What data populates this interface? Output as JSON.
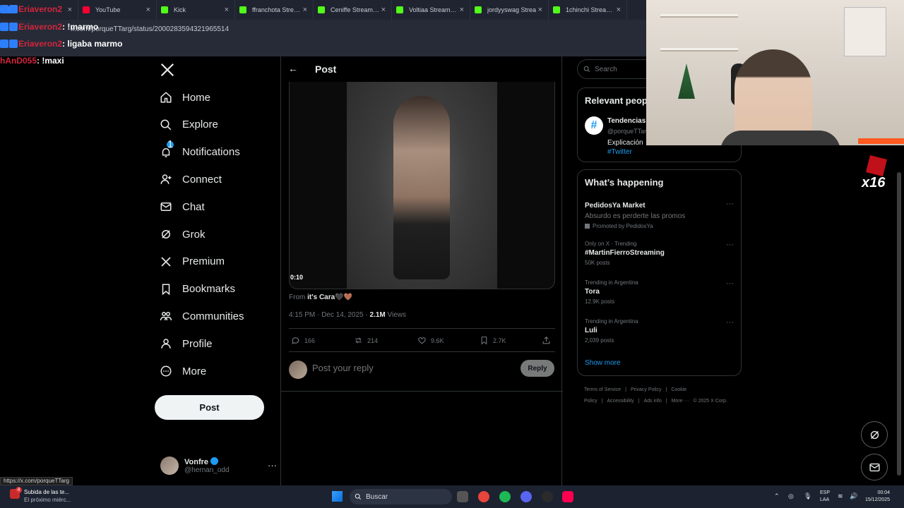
{
  "browser": {
    "tabs": [
      {
        "label": "",
        "color": "#3b82f6"
      },
      {
        "label": "YouTube",
        "color": "#ff0033"
      },
      {
        "label": "Kick",
        "color": "#53fc18"
      },
      {
        "label": "ffranchota Stream",
        "color": "#53fc18"
      },
      {
        "label": "Ceniffe Stream - Vi",
        "color": "#53fc18"
      },
      {
        "label": "Voltiaa Stream - V",
        "color": "#53fc18"
      },
      {
        "label": "jordyyswag Strea",
        "color": "#53fc18"
      },
      {
        "label": "1chinchi Stream -",
        "color": "#53fc18"
      }
    ],
    "address": "x.com/porqueTTarg/status/2000283594321965514"
  },
  "chat": [
    {
      "user": "Eriaveron2",
      "msg": ""
    },
    {
      "user": "Eriaveron2",
      "msg": ": !marmo"
    },
    {
      "user": "Eriaveron2",
      "msg": ": ligaba marmo"
    },
    {
      "user": "hAnD055",
      "msg": ": !maxi"
    }
  ],
  "nav": {
    "items": [
      {
        "label": "Home",
        "icon": "home-icon"
      },
      {
        "label": "Explore",
        "icon": "search-icon"
      },
      {
        "label": "Notifications",
        "icon": "bell-icon"
      },
      {
        "label": "Connect",
        "icon": "person-plus-icon"
      },
      {
        "label": "Chat",
        "icon": "mail-icon"
      },
      {
        "label": "Grok",
        "icon": "grok-icon"
      },
      {
        "label": "Premium",
        "icon": "x-icon"
      },
      {
        "label": "Bookmarks",
        "icon": "bookmark-icon"
      },
      {
        "label": "Communities",
        "icon": "communities-icon"
      },
      {
        "label": "Profile",
        "icon": "person-icon"
      },
      {
        "label": "More",
        "icon": "more-circle-icon"
      }
    ],
    "notif_badge": "1",
    "post_button": "Post",
    "account": {
      "name": "Vonfre",
      "handle": "@hernan_odd"
    }
  },
  "post": {
    "header": "Post",
    "duration": "0:10",
    "from_prefix": "From",
    "from_name": "it's Cara🖤🤎",
    "timestamp": "4:15 PM · Dec 14, 2025 · ",
    "views_count": "2.1M",
    "views_label": " Views",
    "replies": "166",
    "reposts": "214",
    "likes": "9.6K",
    "bookmarks": "2.7K",
    "reply_placeholder": "Post your reply",
    "reply_button": "Reply"
  },
  "sidebar": {
    "search_placeholder": "Search",
    "relevant": {
      "title": "Relevant people",
      "name": "Tendencias",
      "handle": "@porqueTTarg",
      "desc": "Explicación",
      "tag": "#Twitter"
    },
    "happening": {
      "title": "What’s happening",
      "trends": [
        {
          "context": "",
          "name": "PedidosYa Market",
          "sub": "Absurdo es perderte las promos",
          "count": "Promoted by PedidosYa"
        },
        {
          "context": "Only on X · Trending",
          "name": "#MartinFierroStreaming",
          "sub": "",
          "count": "50K posts"
        },
        {
          "context": "Trending in Argentina",
          "name": "Tora",
          "sub": "",
          "count": "12.9K posts"
        },
        {
          "context": "Trending in Argentina",
          "name": "Luli",
          "sub": "",
          "count": "2,039 posts"
        }
      ],
      "show_more": "Show more"
    },
    "footer": [
      "Terms of Service",
      "|",
      "Privacy Policy",
      "|",
      "Cookie Policy",
      "|",
      "Accessibility",
      "|",
      "Ads info",
      "|",
      "More ···",
      "© 2025 X Corp."
    ]
  },
  "overlay": {
    "x16": "x16"
  },
  "status_url": "https://x.com/porqueTTarg",
  "taskbar": {
    "notif_title": "Subida de las te...",
    "notif_sub": "El próximo miérc...",
    "notif_count": "4",
    "search": "Buscar",
    "lang1": "ESP",
    "lang2": "LAA",
    "time": "00:04",
    "date": "15/12/2025"
  }
}
